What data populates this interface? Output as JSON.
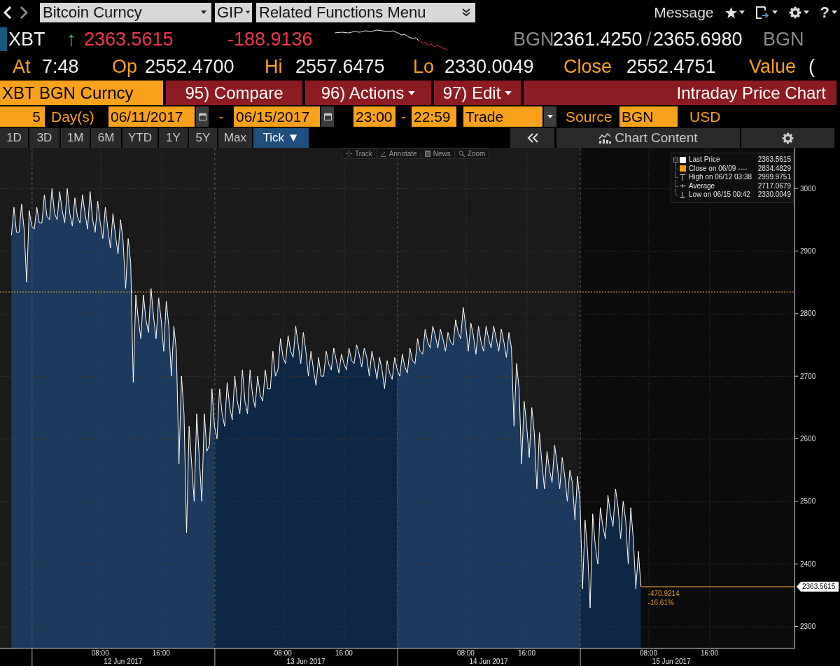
{
  "top_bar": {
    "nav": [
      {
        "kind": "back",
        "disabled": false
      },
      {
        "kind": "forward",
        "disabled": true
      }
    ],
    "security_dropdown": "Bitcoin Curncy",
    "source_dropdown": "GIP",
    "functions_menu": "Related Functions Menu",
    "message": "Message",
    "help": "?"
  },
  "quote": {
    "ticker": "XBT",
    "direction": "↑",
    "last_price": "2363.5615",
    "net_change": "-188.9136",
    "bid_source": "BGN",
    "bid": "2361.4250",
    "separator": "/",
    "ask": "2365.6980",
    "ask_source": "BGN"
  },
  "stats": [
    {
      "label": "At",
      "value": "7:48"
    },
    {
      "label": "Op",
      "value": "2552.4700"
    },
    {
      "label": "Hi",
      "value": "2557.6475"
    },
    {
      "label": "Lo",
      "value": "2330.0049"
    },
    {
      "label": "Close",
      "value": "2552.4751"
    },
    {
      "label": "Value",
      "value": "("
    }
  ],
  "action_bar": {
    "security": "XBT BGN Curncy",
    "buttons": [
      {
        "label": "95) Compare",
        "dropdown": false
      },
      {
        "label": "96) Actions",
        "dropdown": true
      },
      {
        "label": "97) Edit",
        "dropdown": true
      }
    ],
    "title": "Intraday Price Chart"
  },
  "settings_bar": {
    "period_count": "5",
    "period_unit": "Day(s)",
    "start_date": "06/11/2017",
    "date_separator": "-",
    "end_date": "06/15/2017",
    "start_time": "23:00",
    "time_separator": "-",
    "end_time": "22:59",
    "event": "Trade",
    "source_label": "Source",
    "source": "BGN",
    "currency": "USD"
  },
  "range_tabs": [
    {
      "label": "1D",
      "selected": false
    },
    {
      "label": "3D",
      "selected": false
    },
    {
      "label": "1M",
      "selected": false
    },
    {
      "label": "6M",
      "selected": false
    },
    {
      "label": "YTD",
      "selected": false
    },
    {
      "label": "1Y",
      "selected": false
    },
    {
      "label": "5Y",
      "selected": false
    },
    {
      "label": "Max",
      "selected": false
    },
    {
      "label": "Tick ▼",
      "selected": true
    }
  ],
  "panel": {
    "content_button": "Chart Content"
  },
  "chart": {
    "tools": [
      {
        "kind": "track",
        "label": "Track"
      },
      {
        "kind": "annotate",
        "label": "Annotate"
      },
      {
        "kind": "news",
        "label": "News"
      },
      {
        "kind": "zoom",
        "label": "Zoom"
      }
    ],
    "legend": {
      "expanded": true,
      "items": [
        {
          "kind": "series",
          "value": "2363.5615"
        },
        {
          "kind": "swatch",
          "label": "Close on 06/09 ----",
          "value": "2834.4829",
          "color": "#f39c12"
        },
        {
          "kind": "high",
          "label": "High on 06/12 03:38",
          "value": "2999.9751"
        },
        {
          "kind": "average",
          "label": "Average",
          "value": "2717.0679"
        },
        {
          "kind": "low",
          "label": "Low on 06/15 00:42",
          "value": "2330.0049"
        }
      ]
    },
    "date_labels": [
      "12 Jun 2017",
      "13 Jun 2017",
      "14 Jun 2017",
      "15 Jun 2017"
    ],
    "change": "-470.9214",
    "change_percent": "-16.61%",
    "chart_data": {
      "type": "area",
      "grid": true,
      "categories": [
        null,
        null,
        null,
        null,
        null,
        null,
        null,
        null,
        null,
        null,
        null,
        null,
        null,
        null,
        null,
        null,
        null,
        null,
        null,
        null,
        null,
        null,
        null,
        null,
        null,
        null,
        null,
        null,
        null,
        null,
        null,
        null,
        null,
        null,
        null,
        null,
        null,
        null,
        null,
        "08:00",
        null,
        null,
        null,
        null,
        null,
        null,
        null,
        null,
        null,
        null,
        null,
        null,
        null,
        null,
        null,
        null,
        null,
        null,
        null,
        null,
        null,
        null,
        null,
        "16:00",
        null,
        null,
        null,
        null,
        null,
        null,
        null,
        null,
        null,
        null,
        null,
        null,
        null,
        null,
        null,
        null,
        null,
        null,
        null,
        null,
        null,
        null,
        null,
        null,
        null,
        null,
        null,
        null,
        null,
        null,
        null,
        null,
        null,
        null,
        null,
        null,
        null,
        null,
        null,
        null,
        null,
        null,
        null,
        null,
        null,
        null,
        null,
        "08:00",
        null,
        null,
        null,
        null,
        null,
        null,
        null,
        null,
        null,
        null,
        null,
        null,
        null,
        null,
        null,
        null,
        null,
        null,
        null,
        null,
        null,
        null,
        null,
        "16:00",
        null,
        null,
        null,
        null,
        null,
        null,
        null,
        null,
        null,
        null,
        null,
        null,
        null,
        null,
        null,
        null,
        null,
        null,
        null,
        null,
        null,
        null,
        null,
        null,
        null,
        null,
        null,
        null,
        null,
        null,
        null,
        null,
        null,
        null,
        null,
        null,
        null,
        null,
        null,
        null,
        null,
        null,
        null,
        null,
        null,
        null,
        null,
        "08:00",
        null,
        null,
        null,
        null,
        null,
        null,
        null,
        null,
        null,
        null,
        null,
        null,
        null,
        null,
        null,
        null,
        null,
        null,
        null,
        null,
        null,
        null,
        null,
        "16:00",
        null,
        null,
        null,
        null,
        null,
        null,
        null,
        null,
        null,
        null,
        null,
        null,
        null,
        null,
        null,
        null,
        null,
        null,
        null,
        null,
        null,
        null,
        null,
        null,
        null,
        null,
        null,
        null,
        null,
        null,
        null,
        null,
        null,
        null,
        null,
        null,
        null,
        null,
        null,
        null,
        null,
        null,
        null,
        null,
        null,
        null,
        null,
        "08:00",
        null,
        null,
        null,
        null,
        null,
        null,
        null,
        null,
        null,
        null,
        null,
        null,
        null,
        null,
        null,
        null,
        null,
        null,
        null,
        null,
        null,
        null,
        null,
        "16:00",
        null,
        null,
        null,
        null,
        null,
        null,
        null,
        null,
        null,
        null,
        null,
        null,
        null,
        null,
        null,
        null,
        null,
        null,
        null,
        null,
        null,
        null,
        null,
        null,
        null,
        null,
        null,
        null,
        null,
        null,
        null,
        null,
        null
      ],
      "series": [
        {
          "name": "Last Price",
          "color": "#ffffff",
          "values": [
            null,
            null,
            null,
            null,
            2925,
            2970,
            2930,
            2930,
            2975,
            2935,
            2850,
            2965,
            2940,
            2935,
            2970,
            2945,
            2945,
            2990,
            2955,
            2950,
            3000,
            2960,
            2950,
            2995,
            2965,
            2945,
            3000,
            2960,
            2940,
            2985,
            2955,
            2945,
            2990,
            2960,
            2935,
            2995,
            2950,
            2930,
            2980,
            2945,
            2920,
            2970,
            2935,
            2905,
            2960,
            2925,
            2895,
            2950,
            2915,
            2840,
            2920,
            2880,
            2690,
            2830,
            2790,
            2760,
            2830,
            2790,
            2770,
            2840,
            2795,
            2760,
            2825,
            2790,
            2740,
            2820,
            2780,
            2700,
            2780,
            2740,
            2560,
            2700,
            2640,
            2450,
            2620,
            2560,
            2500,
            2640,
            2570,
            2500,
            2640,
            2580,
            2590,
            2680,
            2620,
            2600,
            2680,
            2640,
            2620,
            2690,
            2650,
            2630,
            2700,
            2660,
            2640,
            2710,
            2660,
            2640,
            2710,
            2670,
            2650,
            2700,
            2670,
            2660,
            2710,
            2680,
            2680,
            2740,
            2700,
            2710,
            2760,
            2730,
            2720,
            2765,
            2740,
            2730,
            2780,
            2750,
            2720,
            2770,
            2740,
            2700,
            2740,
            2710,
            2685,
            2730,
            2700,
            2700,
            2740,
            2720,
            2710,
            2745,
            2725,
            2705,
            2735,
            2720,
            2710,
            2745,
            2725,
            2720,
            2750,
            2735,
            2715,
            2745,
            2730,
            2700,
            2740,
            2720,
            2695,
            2730,
            2710,
            2680,
            2725,
            2705,
            2695,
            2730,
            2710,
            2700,
            2735,
            2715,
            2705,
            2745,
            2725,
            2720,
            2760,
            2740,
            2735,
            2775,
            2755,
            2745,
            2780,
            2765,
            2745,
            2775,
            2760,
            2740,
            2770,
            2755,
            2750,
            2790,
            2770,
            2760,
            2810,
            2780,
            2740,
            2785,
            2765,
            2735,
            2780,
            2755,
            2740,
            2780,
            2760,
            2745,
            2780,
            2760,
            2740,
            2775,
            2755,
            2730,
            2770,
            2745,
            2620,
            2720,
            2680,
            2560,
            2660,
            2620,
            2570,
            2650,
            2610,
            2520,
            2610,
            2560,
            2520,
            2580,
            2550,
            2530,
            2590,
            2560,
            2520,
            2570,
            2540,
            2500,
            2550,
            2530,
            2470,
            2540,
            2500,
            2360,
            2470,
            2420,
            2330,
            2480,
            2430,
            2400,
            2490,
            2460,
            2440,
            2510,
            2480,
            2460,
            2520,
            2490,
            2440,
            2500,
            2470,
            2400,
            2490,
            2440,
            2360,
            2420,
            2364,
            null,
            null,
            null,
            null,
            null,
            null,
            null,
            null,
            null,
            null,
            null,
            null,
            null,
            null,
            null,
            null,
            null,
            null,
            null,
            null,
            null,
            null,
            null,
            null,
            null,
            null,
            null,
            null,
            null,
            null,
            null,
            null,
            null,
            null,
            null,
            null,
            null,
            null,
            null,
            null,
            null,
            null,
            null,
            null,
            null,
            null,
            null,
            null,
            null,
            null,
            null,
            null,
            null,
            null,
            null,
            null,
            null,
            null,
            null,
            null
          ]
        }
      ],
      "ylim": [
        2266,
        3065
      ],
      "yticks": [
        2300,
        2400,
        2500,
        2600,
        2700,
        2800,
        2900,
        3000
      ],
      "ref_lines": [
        {
          "axis": "y",
          "value": 2834.4829
        },
        {
          "axis": "y",
          "value": 2363.5615,
          "label": "2363.5615"
        }
      ]
    }
  }
}
